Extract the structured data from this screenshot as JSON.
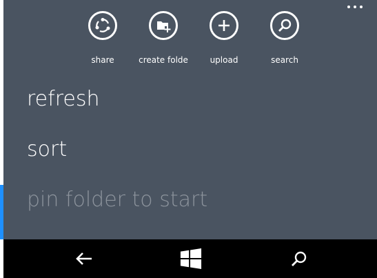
{
  "app_bar": {
    "actions": [
      {
        "label": "share",
        "icon": "share-icon"
      },
      {
        "label": "create folde",
        "icon": "create-folder-icon"
      },
      {
        "label": "upload",
        "icon": "upload-icon"
      },
      {
        "label": "search",
        "icon": "search-icon"
      }
    ],
    "more_icon": "more-ellipsis-icon"
  },
  "menu": {
    "items": [
      {
        "label": "refresh",
        "enabled": true
      },
      {
        "label": "sort",
        "enabled": true
      },
      {
        "label": "pin folder to start",
        "enabled": false
      }
    ]
  },
  "nav_bar": {
    "back_icon": "back-arrow-icon",
    "start_icon": "windows-start-icon",
    "search_icon": "search-icon"
  },
  "colors": {
    "app_bar_bg": "#4a5461",
    "nav_bar_bg": "#000000",
    "accent": "#1e90ff",
    "text": "#ffffff",
    "disabled_text": "#8d949d"
  }
}
